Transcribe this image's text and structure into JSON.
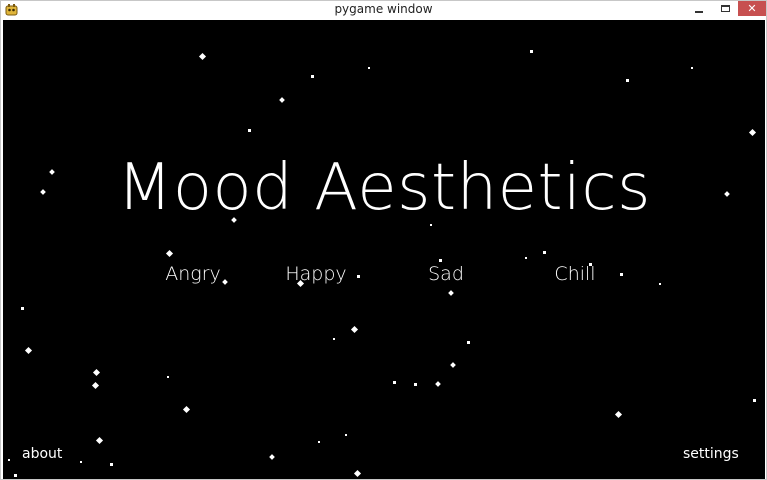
{
  "window": {
    "title": "pygame window",
    "close_symbol": "✕"
  },
  "screen": {
    "background_color": "#000000",
    "text_color": "#ffffff",
    "title": "Mood Aesthetics",
    "moods": [
      "Angry",
      "Happy",
      "Sad",
      "Chill"
    ],
    "about_label": "about",
    "settings_label": "settings"
  },
  "icons": {
    "app": "pygame-icon",
    "minimize": "minimize-icon",
    "maximize": "maximize-icon",
    "close": "close-icon"
  }
}
